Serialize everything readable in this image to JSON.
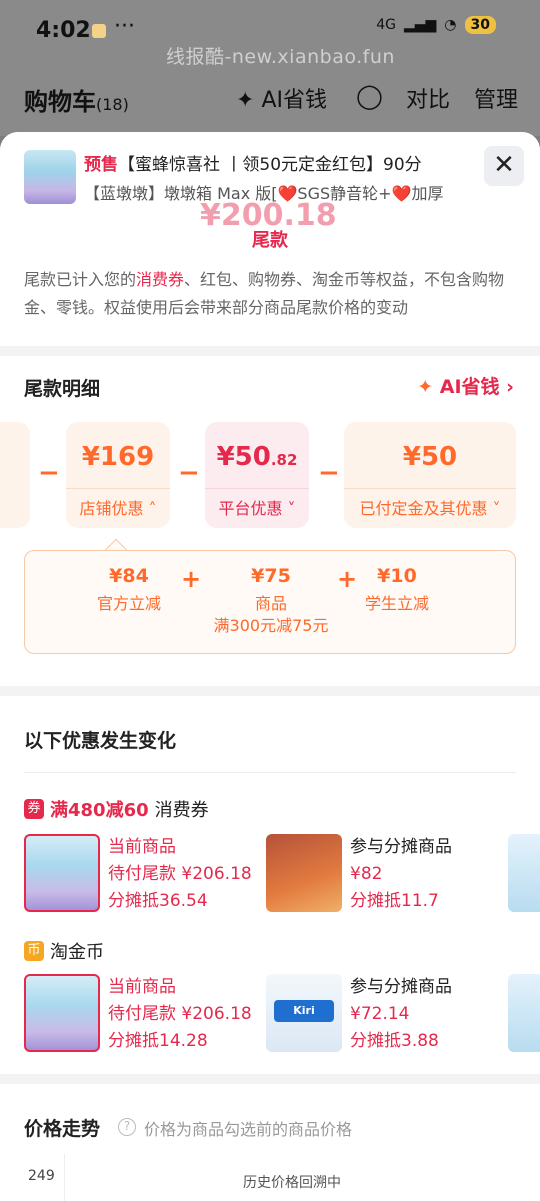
{
  "status": {
    "time": "4:02",
    "more": "···",
    "network": "4G",
    "battery": "30",
    "watermark": "线报酷-new.xianbao.fun"
  },
  "header": {
    "title": "购物车",
    "count": "(18)",
    "ai_label": "AI省钱",
    "compare": "对比",
    "manage": "管理"
  },
  "product": {
    "presale": "预售",
    "title_rest": "【蜜蜂惊喜社 丨领50元定金红包】90分",
    "subtitle": "【蓝墩墩】墩墩箱 Max 版[❤️SGS静音轮+❤️加厚",
    "price_partial": "¥200.18",
    "final_label": "尾款",
    "desc_prefix": "尾款已计入您的",
    "desc_highlight": "消费券",
    "desc_rest": "、红包、购物券、淘金币等权益，不包含购物金、零钱。权益使用后会带来部分商品尾款价格的变动"
  },
  "detail": {
    "title": "尾款明细",
    "ai_link": "AI省钱",
    "chips": [
      {
        "amount": "¥169",
        "label": "店铺优惠"
      },
      {
        "amount": "¥50",
        "amount_small": ".82",
        "label": "平台优惠"
      },
      {
        "amount": "¥50",
        "label": "已付定金及其优惠"
      }
    ],
    "breakdown": [
      {
        "value": "¥84",
        "label": "官方立减"
      },
      {
        "value": "¥75",
        "label": "商品",
        "sub": "满300元减75元"
      },
      {
        "value": "¥10",
        "label": "学生立减"
      }
    ]
  },
  "changes": {
    "title": "以下优惠发生变化",
    "coupon": {
      "badge": "券",
      "name_red": "满480减60",
      "name_rest": "消费券"
    },
    "coupon_rows": {
      "current": {
        "label": "当前商品",
        "pending": "待付尾款 ¥206.18",
        "share": "分摊抵36.54"
      },
      "other": {
        "label": "参与分摊商品",
        "price": "¥82",
        "share": "分摊抵11.7"
      }
    },
    "coin": {
      "badge": "币",
      "name": "淘金币"
    },
    "coin_rows": {
      "current": {
        "label": "当前商品",
        "pending": "待付尾款 ¥206.18",
        "share": "分摊抵14.28"
      },
      "other": {
        "label": "参与分摊商品",
        "price": "¥72.14",
        "share": "分摊抵3.88",
        "brand": "Kiri"
      }
    }
  },
  "trend": {
    "title": "价格走势",
    "help": "?",
    "note": "价格为商品勾选前的商品价格",
    "y_tick": "249",
    "message": "历史价格回溯中"
  }
}
